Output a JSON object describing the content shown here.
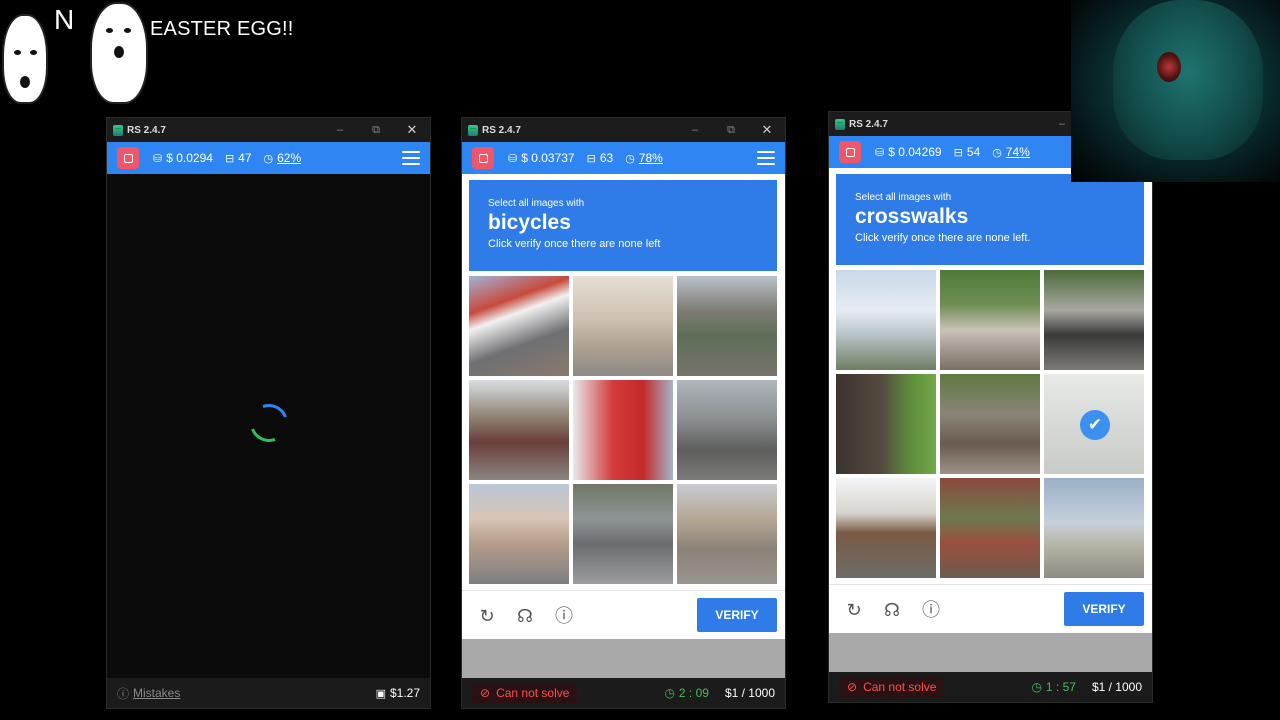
{
  "overlay": {
    "letter": "N",
    "caption": "EASTER EGG!!"
  },
  "windows": [
    {
      "title": "RS 2.4.7",
      "balance": "$ 0.0294",
      "count": "47",
      "accuracy": "62%",
      "footer_left": "Mistakes",
      "footer_right": "$1.27"
    },
    {
      "title": "RS 2.4.7",
      "balance": "$ 0.03737",
      "count": "63",
      "accuracy": "78%",
      "captcha": {
        "line1": "Select all images with",
        "target": "bicycles",
        "line3": "Click verify once there are none left",
        "verify_label": "VERIFY"
      },
      "footer_left": "Can not solve",
      "timer": "2 : 09",
      "counter": "$1 / 1000"
    },
    {
      "title": "RS 2.4.7",
      "balance": "$ 0.04269",
      "count": "54",
      "accuracy": "74%",
      "captcha": {
        "line1": "Select all images with",
        "target": "crosswalks",
        "line3": "Click verify once there are none left.",
        "verify_label": "VERIFY"
      },
      "footer_left": "Can not solve",
      "timer": "1 : 57",
      "counter": "$1 / 1000"
    }
  ],
  "icons": {
    "coins": "⛁",
    "chat": "⊟",
    "clock": "◷",
    "info": "ⓘ",
    "wallet": "▣",
    "ban": "⊘",
    "refresh": "↻",
    "headphones": "☊",
    "check": "✔",
    "minimize": "–",
    "restore": "⧉",
    "close": "✕"
  },
  "colors": {
    "accent": "#2f86f3",
    "stop": "#f0566a",
    "error": "#ff4f4f",
    "timer": "#3fbf5f"
  }
}
